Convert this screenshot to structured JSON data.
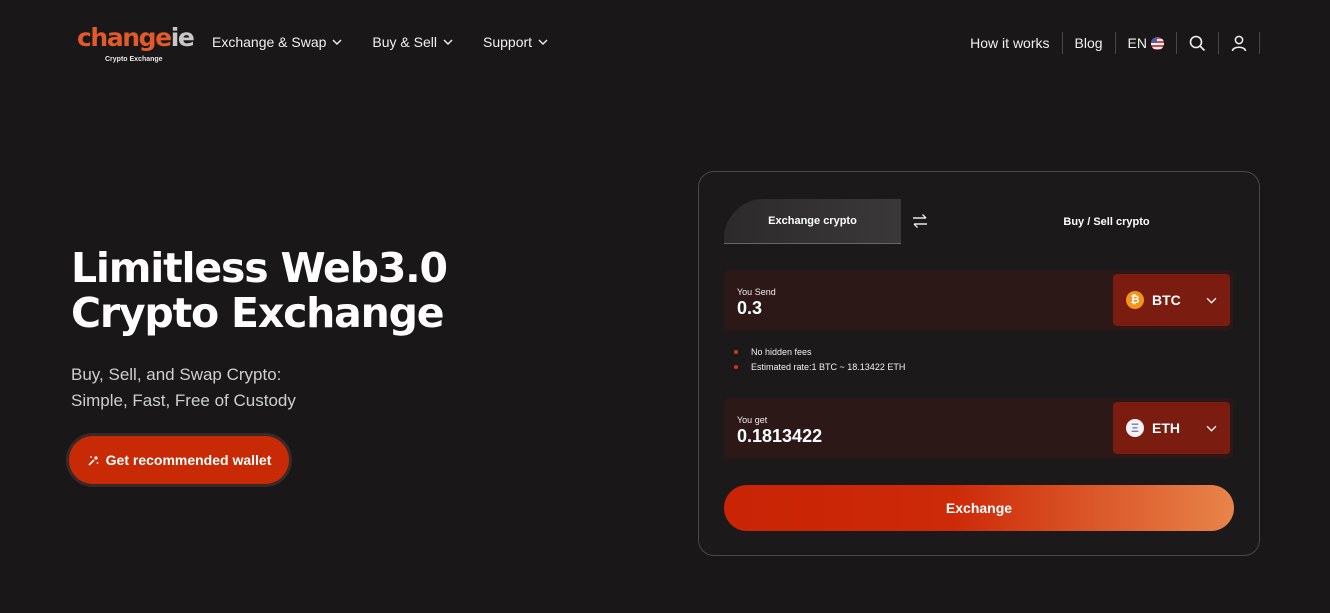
{
  "colors": {
    "accent": "#c92a06",
    "background": "#191717",
    "field": "#2d1818",
    "coin_button": "#7a1d10"
  },
  "header": {
    "logo_main": "change",
    "logo_tail": "ie",
    "logo_sub": "Crypto Exchange",
    "nav": [
      {
        "label": "Exchange & Swap",
        "icon": "chevron-down-icon"
      },
      {
        "label": "Buy & Sell",
        "icon": "chevron-down-icon"
      },
      {
        "label": "Support",
        "icon": "chevron-down-icon"
      }
    ],
    "right": {
      "how_it_works": "How it works",
      "blog": "Blog",
      "language": "EN",
      "language_flag": "us-flag-icon",
      "search_icon": "search-icon",
      "user_icon": "user-icon"
    }
  },
  "hero": {
    "title_line1": "Limitless Web3.0",
    "title_line2": "Crypto Exchange",
    "subtitle_line1": "Buy, Sell, and Swap Crypto:",
    "subtitle_line2": "Simple, Fast, Free of Custody",
    "wallet_button": "Get recommended wallet",
    "wallet_icon": "wallet-icon"
  },
  "exchange_card": {
    "tabs": {
      "active": "Exchange crypto",
      "inactive": "Buy / Sell crypto",
      "swap_icon": "swap-arrows-icon"
    },
    "send": {
      "label": "You Send",
      "value": "0.3",
      "coin": "BTC",
      "coin_symbol": "₿"
    },
    "info": [
      "No hidden fees",
      "Estimated rate:1 BTC ~ 18.13422 ETH"
    ],
    "get": {
      "label": "You get",
      "value": "0.1813422",
      "coin": "ETH",
      "coin_symbol": "Ξ"
    },
    "exchange_button": "Exchange"
  }
}
